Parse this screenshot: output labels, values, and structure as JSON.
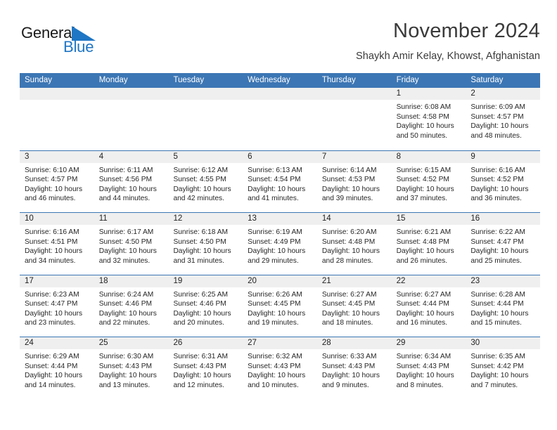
{
  "brand": {
    "name_part1": "General",
    "name_part2": "Blue",
    "triangle_color": "#1f76c4"
  },
  "header": {
    "title": "November 2024",
    "subtitle": "Shaykh Amir Kelay, Khowst, Afghanistan"
  },
  "theme": {
    "header_blue": "#3c76b4",
    "date_strip_gray": "#efefef",
    "logo_blue": "#1f76c4",
    "text_dark": "#3a3a3a"
  },
  "weekday_headers": [
    "Sunday",
    "Monday",
    "Tuesday",
    "Wednesday",
    "Thursday",
    "Friday",
    "Saturday"
  ],
  "weeks": [
    [
      {
        "date": "",
        "empty": true,
        "sunrise": "",
        "sunset": "",
        "daylight_line1": "",
        "daylight_line2": ""
      },
      {
        "date": "",
        "empty": true,
        "sunrise": "",
        "sunset": "",
        "daylight_line1": "",
        "daylight_line2": ""
      },
      {
        "date": "",
        "empty": true,
        "sunrise": "",
        "sunset": "",
        "daylight_line1": "",
        "daylight_line2": ""
      },
      {
        "date": "",
        "empty": true,
        "sunrise": "",
        "sunset": "",
        "daylight_line1": "",
        "daylight_line2": ""
      },
      {
        "date": "",
        "empty": true,
        "sunrise": "",
        "sunset": "",
        "daylight_line1": "",
        "daylight_line2": ""
      },
      {
        "date": "1",
        "empty": false,
        "sunrise": "Sunrise: 6:08 AM",
        "sunset": "Sunset: 4:58 PM",
        "daylight_line1": "Daylight: 10 hours",
        "daylight_line2": "and 50 minutes."
      },
      {
        "date": "2",
        "empty": false,
        "sunrise": "Sunrise: 6:09 AM",
        "sunset": "Sunset: 4:57 PM",
        "daylight_line1": "Daylight: 10 hours",
        "daylight_line2": "and 48 minutes."
      }
    ],
    [
      {
        "date": "3",
        "empty": false,
        "sunrise": "Sunrise: 6:10 AM",
        "sunset": "Sunset: 4:57 PM",
        "daylight_line1": "Daylight: 10 hours",
        "daylight_line2": "and 46 minutes."
      },
      {
        "date": "4",
        "empty": false,
        "sunrise": "Sunrise: 6:11 AM",
        "sunset": "Sunset: 4:56 PM",
        "daylight_line1": "Daylight: 10 hours",
        "daylight_line2": "and 44 minutes."
      },
      {
        "date": "5",
        "empty": false,
        "sunrise": "Sunrise: 6:12 AM",
        "sunset": "Sunset: 4:55 PM",
        "daylight_line1": "Daylight: 10 hours",
        "daylight_line2": "and 42 minutes."
      },
      {
        "date": "6",
        "empty": false,
        "sunrise": "Sunrise: 6:13 AM",
        "sunset": "Sunset: 4:54 PM",
        "daylight_line1": "Daylight: 10 hours",
        "daylight_line2": "and 41 minutes."
      },
      {
        "date": "7",
        "empty": false,
        "sunrise": "Sunrise: 6:14 AM",
        "sunset": "Sunset: 4:53 PM",
        "daylight_line1": "Daylight: 10 hours",
        "daylight_line2": "and 39 minutes."
      },
      {
        "date": "8",
        "empty": false,
        "sunrise": "Sunrise: 6:15 AM",
        "sunset": "Sunset: 4:52 PM",
        "daylight_line1": "Daylight: 10 hours",
        "daylight_line2": "and 37 minutes."
      },
      {
        "date": "9",
        "empty": false,
        "sunrise": "Sunrise: 6:16 AM",
        "sunset": "Sunset: 4:52 PM",
        "daylight_line1": "Daylight: 10 hours",
        "daylight_line2": "and 36 minutes."
      }
    ],
    [
      {
        "date": "10",
        "empty": false,
        "sunrise": "Sunrise: 6:16 AM",
        "sunset": "Sunset: 4:51 PM",
        "daylight_line1": "Daylight: 10 hours",
        "daylight_line2": "and 34 minutes."
      },
      {
        "date": "11",
        "empty": false,
        "sunrise": "Sunrise: 6:17 AM",
        "sunset": "Sunset: 4:50 PM",
        "daylight_line1": "Daylight: 10 hours",
        "daylight_line2": "and 32 minutes."
      },
      {
        "date": "12",
        "empty": false,
        "sunrise": "Sunrise: 6:18 AM",
        "sunset": "Sunset: 4:50 PM",
        "daylight_line1": "Daylight: 10 hours",
        "daylight_line2": "and 31 minutes."
      },
      {
        "date": "13",
        "empty": false,
        "sunrise": "Sunrise: 6:19 AM",
        "sunset": "Sunset: 4:49 PM",
        "daylight_line1": "Daylight: 10 hours",
        "daylight_line2": "and 29 minutes."
      },
      {
        "date": "14",
        "empty": false,
        "sunrise": "Sunrise: 6:20 AM",
        "sunset": "Sunset: 4:48 PM",
        "daylight_line1": "Daylight: 10 hours",
        "daylight_line2": "and 28 minutes."
      },
      {
        "date": "15",
        "empty": false,
        "sunrise": "Sunrise: 6:21 AM",
        "sunset": "Sunset: 4:48 PM",
        "daylight_line1": "Daylight: 10 hours",
        "daylight_line2": "and 26 minutes."
      },
      {
        "date": "16",
        "empty": false,
        "sunrise": "Sunrise: 6:22 AM",
        "sunset": "Sunset: 4:47 PM",
        "daylight_line1": "Daylight: 10 hours",
        "daylight_line2": "and 25 minutes."
      }
    ],
    [
      {
        "date": "17",
        "empty": false,
        "sunrise": "Sunrise: 6:23 AM",
        "sunset": "Sunset: 4:47 PM",
        "daylight_line1": "Daylight: 10 hours",
        "daylight_line2": "and 23 minutes."
      },
      {
        "date": "18",
        "empty": false,
        "sunrise": "Sunrise: 6:24 AM",
        "sunset": "Sunset: 4:46 PM",
        "daylight_line1": "Daylight: 10 hours",
        "daylight_line2": "and 22 minutes."
      },
      {
        "date": "19",
        "empty": false,
        "sunrise": "Sunrise: 6:25 AM",
        "sunset": "Sunset: 4:46 PM",
        "daylight_line1": "Daylight: 10 hours",
        "daylight_line2": "and 20 minutes."
      },
      {
        "date": "20",
        "empty": false,
        "sunrise": "Sunrise: 6:26 AM",
        "sunset": "Sunset: 4:45 PM",
        "daylight_line1": "Daylight: 10 hours",
        "daylight_line2": "and 19 minutes."
      },
      {
        "date": "21",
        "empty": false,
        "sunrise": "Sunrise: 6:27 AM",
        "sunset": "Sunset: 4:45 PM",
        "daylight_line1": "Daylight: 10 hours",
        "daylight_line2": "and 18 minutes."
      },
      {
        "date": "22",
        "empty": false,
        "sunrise": "Sunrise: 6:27 AM",
        "sunset": "Sunset: 4:44 PM",
        "daylight_line1": "Daylight: 10 hours",
        "daylight_line2": "and 16 minutes."
      },
      {
        "date": "23",
        "empty": false,
        "sunrise": "Sunrise: 6:28 AM",
        "sunset": "Sunset: 4:44 PM",
        "daylight_line1": "Daylight: 10 hours",
        "daylight_line2": "and 15 minutes."
      }
    ],
    [
      {
        "date": "24",
        "empty": false,
        "sunrise": "Sunrise: 6:29 AM",
        "sunset": "Sunset: 4:44 PM",
        "daylight_line1": "Daylight: 10 hours",
        "daylight_line2": "and 14 minutes."
      },
      {
        "date": "25",
        "empty": false,
        "sunrise": "Sunrise: 6:30 AM",
        "sunset": "Sunset: 4:43 PM",
        "daylight_line1": "Daylight: 10 hours",
        "daylight_line2": "and 13 minutes."
      },
      {
        "date": "26",
        "empty": false,
        "sunrise": "Sunrise: 6:31 AM",
        "sunset": "Sunset: 4:43 PM",
        "daylight_line1": "Daylight: 10 hours",
        "daylight_line2": "and 12 minutes."
      },
      {
        "date": "27",
        "empty": false,
        "sunrise": "Sunrise: 6:32 AM",
        "sunset": "Sunset: 4:43 PM",
        "daylight_line1": "Daylight: 10 hours",
        "daylight_line2": "and 10 minutes."
      },
      {
        "date": "28",
        "empty": false,
        "sunrise": "Sunrise: 6:33 AM",
        "sunset": "Sunset: 4:43 PM",
        "daylight_line1": "Daylight: 10 hours",
        "daylight_line2": "and 9 minutes."
      },
      {
        "date": "29",
        "empty": false,
        "sunrise": "Sunrise: 6:34 AM",
        "sunset": "Sunset: 4:43 PM",
        "daylight_line1": "Daylight: 10 hours",
        "daylight_line2": "and 8 minutes."
      },
      {
        "date": "30",
        "empty": false,
        "sunrise": "Sunrise: 6:35 AM",
        "sunset": "Sunset: 4:42 PM",
        "daylight_line1": "Daylight: 10 hours",
        "daylight_line2": "and 7 minutes."
      }
    ]
  ]
}
